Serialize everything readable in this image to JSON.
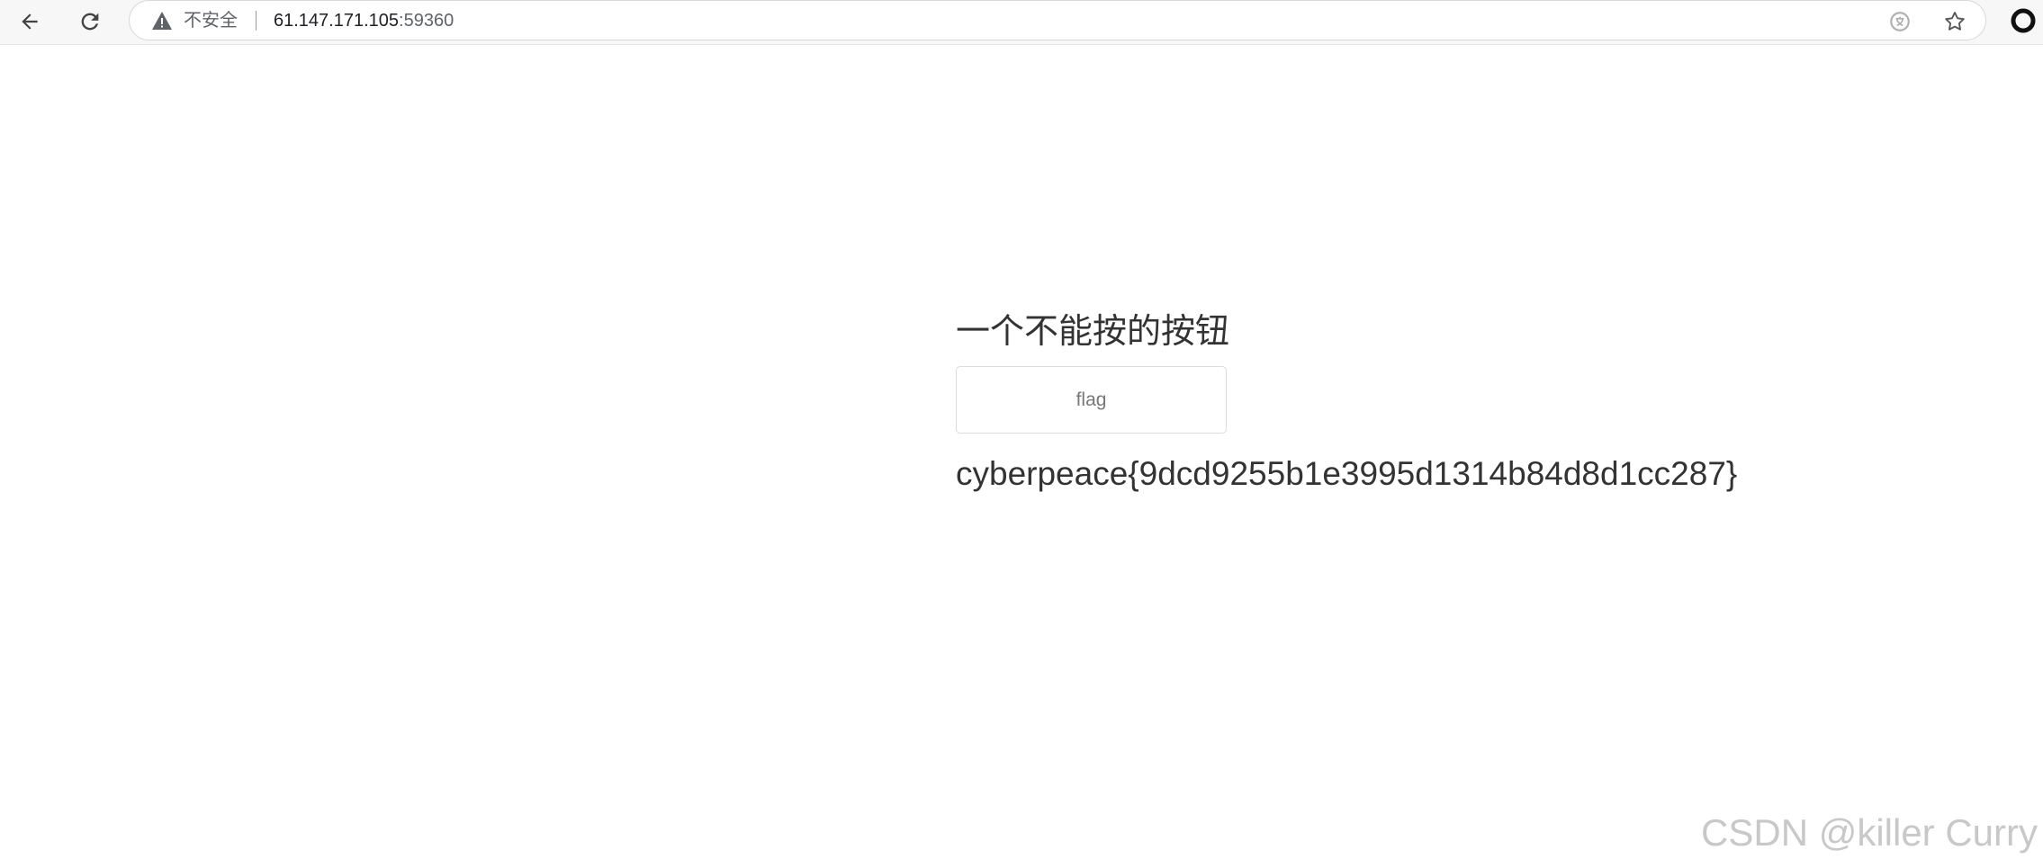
{
  "browser": {
    "security_label": "不安全",
    "url_host": "61.147.171.105",
    "url_port": ":59360",
    "icons": {
      "back": "back-arrow-icon",
      "reload": "reload-icon",
      "warning": "warning-triangle-icon",
      "translate": "translate-icon",
      "bookmark": "star-icon",
      "profile": "profile-icon"
    }
  },
  "page": {
    "heading": "一个不能按的按钮",
    "button_label": "flag",
    "flag_text": "cyberpeace{9dcd9255b1e3995d1314b84d8d1cc287}"
  },
  "watermark": "CSDN @killer Curry",
  "colors": {
    "text": "#333333",
    "button_border": "#dcdcdc",
    "watermark": "#c8c8c8"
  }
}
